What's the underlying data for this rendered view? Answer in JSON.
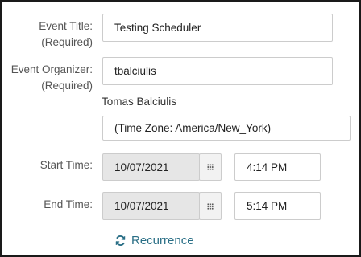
{
  "event_title": {
    "label": "Event Title:",
    "required": "(Required)",
    "value": "Testing Scheduler"
  },
  "event_organizer": {
    "label": "Event Organizer:",
    "required": "(Required)",
    "value": "tbalciulis",
    "display_name": "Tomas Balciulis",
    "time_zone": "(Time Zone: America/New_York)"
  },
  "start_time": {
    "label": "Start Time:",
    "date": "10/07/2021",
    "time": "4:14 PM",
    "calendar_icon": "calendar-grid-icon"
  },
  "end_time": {
    "label": "End Time:",
    "date": "10/07/2021",
    "time": "5:14 PM",
    "calendar_icon": "calendar-grid-icon"
  },
  "recurrence": {
    "label": "Recurrence",
    "icon": "refresh-icon",
    "color": "#2a6f86"
  }
}
